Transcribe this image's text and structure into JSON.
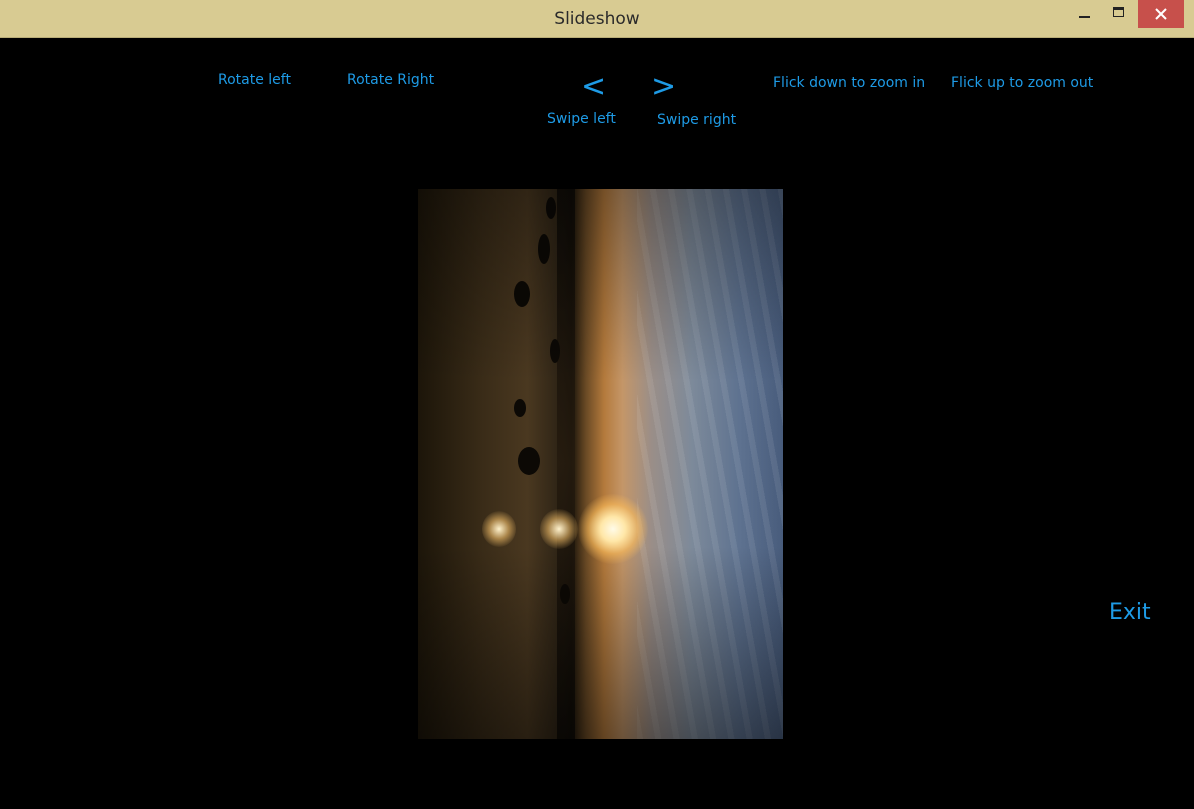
{
  "window": {
    "title": "Slideshow"
  },
  "controls": {
    "rotate_left": "Rotate left",
    "rotate_right": "Rotate Right",
    "swipe_left_arrow": "<",
    "swipe_right_arrow": ">",
    "swipe_left": "Swipe left",
    "swipe_right": "Swipe right",
    "zoom_in": "Flick down to zoom in",
    "zoom_out": "Flick up to zoom out",
    "exit": "Exit"
  },
  "colors": {
    "accent": "#1e9be6",
    "titlebar": "#d8cb92",
    "close_button": "#c7504b",
    "background": "#000000"
  },
  "icons": {
    "minimize": "minimize-icon",
    "maximize": "maximize-icon",
    "close": "close-icon"
  }
}
